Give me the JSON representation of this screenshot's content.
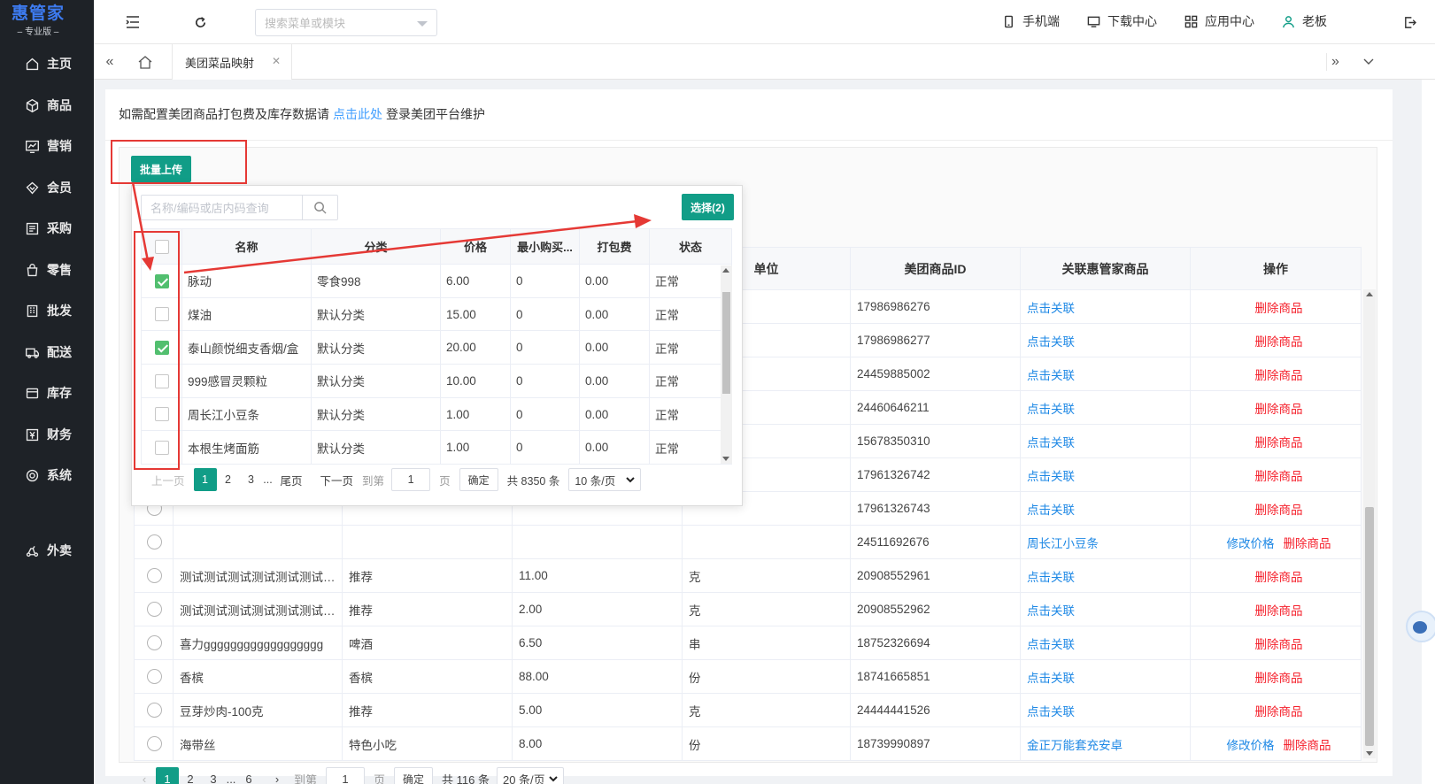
{
  "sidebar": {
    "logo": {
      "brand": "惠管家",
      "edition": "– 专业版 –"
    },
    "items": [
      {
        "label": "主页",
        "icon": "home-icon"
      },
      {
        "label": "商品",
        "icon": "box-icon"
      },
      {
        "label": "营销",
        "icon": "chart-icon"
      },
      {
        "label": "会员",
        "icon": "diamond-icon"
      },
      {
        "label": "采购",
        "icon": "list-icon"
      },
      {
        "label": "零售",
        "icon": "bag-icon"
      },
      {
        "label": "批发",
        "icon": "building-icon"
      },
      {
        "label": "配送",
        "icon": "truck-icon"
      },
      {
        "label": "库存",
        "icon": "stock-icon"
      },
      {
        "label": "财务",
        "icon": "money-icon"
      },
      {
        "label": "系统",
        "icon": "settings-icon"
      },
      {
        "label": "外卖",
        "icon": "delivery-icon"
      }
    ]
  },
  "header": {
    "menu_search_placeholder": "搜索菜单或模块",
    "links": [
      {
        "label": "手机端",
        "icon": "mobile-icon"
      },
      {
        "label": "下载中心",
        "icon": "monitor-icon"
      },
      {
        "label": "应用中心",
        "icon": "apps-icon"
      },
      {
        "label": "老板",
        "icon": "user-icon"
      }
    ]
  },
  "tabs": [
    {
      "label": "美团菜品映射",
      "active": true
    }
  ],
  "notice": {
    "prefix": "如需配置美团商品打包费及库存数据请",
    "link": "点击此处",
    "suffix": "登录美团平台维护"
  },
  "batch_upload_label": "批量上传",
  "main_table": {
    "columns": [
      "",
      "名称",
      "分类",
      "价格",
      "单位",
      "美团商品ID",
      "关联惠管家商品",
      "操作"
    ],
    "rows": [
      {
        "name": "",
        "category": "",
        "price": "",
        "unit": "",
        "mt_id": "17986986276",
        "link": "点击关联",
        "edit": "",
        "delete": "删除商品"
      },
      {
        "name": "",
        "category": "",
        "price": "",
        "unit": "",
        "mt_id": "17986986277",
        "link": "点击关联",
        "edit": "",
        "delete": "删除商品"
      },
      {
        "name": "",
        "category": "",
        "price": "",
        "unit": "",
        "mt_id": "24459885002",
        "link": "点击关联",
        "edit": "",
        "delete": "删除商品"
      },
      {
        "name": "",
        "category": "",
        "price": "",
        "unit": "",
        "mt_id": "24460646211",
        "link": "点击关联",
        "edit": "",
        "delete": "删除商品"
      },
      {
        "name": "",
        "category": "",
        "price": "",
        "unit": "",
        "mt_id": "15678350310",
        "link": "点击关联",
        "edit": "",
        "delete": "删除商品"
      },
      {
        "name": "",
        "category": "",
        "price": "",
        "unit": "",
        "mt_id": "17961326742",
        "link": "点击关联",
        "edit": "",
        "delete": "删除商品"
      },
      {
        "name": "",
        "category": "",
        "price": "",
        "unit": "",
        "mt_id": "17961326743",
        "link": "点击关联",
        "edit": "",
        "delete": "删除商品"
      },
      {
        "name": "",
        "category": "",
        "price": "",
        "unit": "",
        "mt_id": "24511692676",
        "link": "周长江小豆条",
        "edit": "修改价格",
        "delete": "删除商品"
      },
      {
        "name": "测试测试测试测试测试测试测试",
        "category": "推荐",
        "price": "11.00",
        "unit": "克",
        "mt_id": "20908552961",
        "link": "点击关联",
        "edit": "",
        "delete": "删除商品"
      },
      {
        "name": "测试测试测试测试测试测试测试",
        "category": "推荐",
        "price": "2.00",
        "unit": "克",
        "mt_id": "20908552962",
        "link": "点击关联",
        "edit": "",
        "delete": "删除商品"
      },
      {
        "name": "喜力gggggggggggggggggg",
        "category": "啤酒",
        "price": "6.50",
        "unit": "串",
        "mt_id": "18752326694",
        "link": "点击关联",
        "edit": "",
        "delete": "删除商品"
      },
      {
        "name": "香槟",
        "category": "香槟",
        "price": "88.00",
        "unit": "份",
        "mt_id": "18741665851",
        "link": "点击关联",
        "edit": "",
        "delete": "删除商品"
      },
      {
        "name": "豆芽炒肉-100克",
        "category": "推荐",
        "price": "5.00",
        "unit": "克",
        "mt_id": "24444441526",
        "link": "点击关联",
        "edit": "",
        "delete": "删除商品"
      },
      {
        "name": "海带丝",
        "category": "特色小吃",
        "price": "8.00",
        "unit": "份",
        "mt_id": "18739990897",
        "link": "金正万能套充安卓",
        "edit": "修改价格",
        "delete": "删除商品"
      }
    ]
  },
  "main_pager": {
    "pages": [
      "1",
      "2",
      "3",
      "...",
      "6"
    ],
    "goto_label": "到第",
    "goto_value": "1",
    "page_unit": "页",
    "confirm": "确定",
    "total": "共 116 条",
    "page_size": "20 条/页"
  },
  "popup": {
    "search_placeholder": "名称/编码或店内码查询",
    "select_button": "选择(2)",
    "columns": [
      "",
      "名称",
      "分类",
      "价格",
      "最小购买...",
      "打包费",
      "状态"
    ],
    "rows": [
      {
        "checked": true,
        "name": "脉动",
        "category": "零食998",
        "price": "6.00",
        "min": "0",
        "pack": "0.00",
        "status": "正常"
      },
      {
        "checked": false,
        "name": "煤油",
        "category": "默认分类",
        "price": "15.00",
        "min": "0",
        "pack": "0.00",
        "status": "正常"
      },
      {
        "checked": true,
        "name": "泰山颜悦细支香烟/盒",
        "category": "默认分类",
        "price": "20.00",
        "min": "0",
        "pack": "0.00",
        "status": "正常"
      },
      {
        "checked": false,
        "name": "999感冒灵颗粒",
        "category": "默认分类",
        "price": "10.00",
        "min": "0",
        "pack": "0.00",
        "status": "正常"
      },
      {
        "checked": false,
        "name": "周长江小豆条",
        "category": "默认分类",
        "price": "1.00",
        "min": "0",
        "pack": "0.00",
        "status": "正常"
      },
      {
        "checked": false,
        "name": "本根生烤面筋",
        "category": "默认分类",
        "price": "1.00",
        "min": "0",
        "pack": "0.00",
        "status": "正常"
      }
    ],
    "pager": {
      "prev": "上一页",
      "pages": [
        "1",
        "2",
        "3",
        "..."
      ],
      "last": "尾页",
      "next": "下一页",
      "goto_label": "到第",
      "goto_value": "1",
      "page_unit": "页",
      "confirm": "确定",
      "total": "共 8350 条",
      "page_size": "10 条/页"
    }
  },
  "colors": {
    "primary": "#119d87",
    "link": "#1e88e5",
    "danger": "#f5222d",
    "annotation": "#e53935",
    "checkbox": "#52bf6f",
    "sidebar": "#1e2227"
  }
}
